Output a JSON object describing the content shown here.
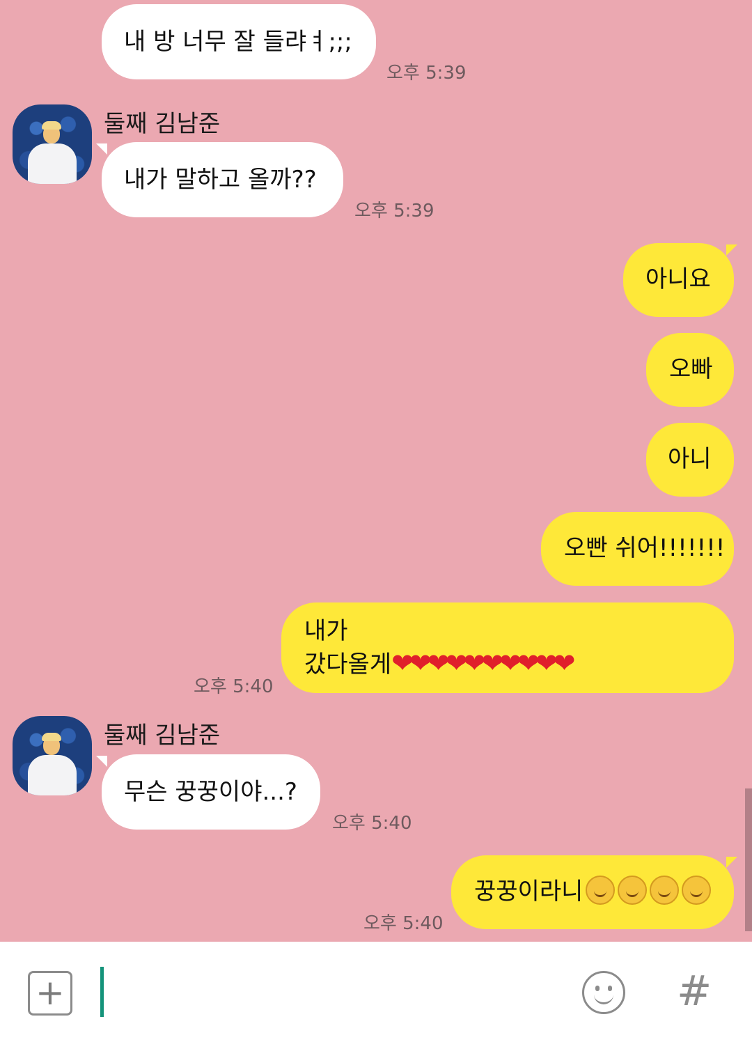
{
  "messages": [
    {
      "text": "내 방 너무 잘 들랴ㅕ;;;",
      "time": "오후 5:39"
    },
    {
      "sender": "둘째 김남준",
      "text": "내가 말하고 올까??",
      "time": "오후 5:39"
    },
    {
      "text": "아니요"
    },
    {
      "text": "오빠"
    },
    {
      "text": "아니"
    },
    {
      "text": "오빤 쉬어!!!!!!!"
    },
    {
      "line1": "내가",
      "line2": "갔다올게",
      "hearts": "❤❤❤❤❤❤❤❤❤❤",
      "time": "오후 5:40"
    },
    {
      "sender": "둘째 김남준",
      "text": "무슨 꿍꿍이야...?",
      "time": "오후 5:40"
    },
    {
      "text": "꿍꿍이라니",
      "time": "오후 5:40"
    }
  ],
  "input": {
    "plus_label": "+",
    "hash_label": "#"
  },
  "icons": {
    "plus": "plus-square-icon",
    "emoji": "smiley-face-icon",
    "hash": "hashtag-icon",
    "heart": "red-heart-emoji",
    "smile": "smiling-face-emoji"
  },
  "colors": {
    "background": "#eba8b1",
    "incoming_bubble": "#ffffff",
    "outgoing_bubble": "#fee839",
    "cursor": "#14937a"
  }
}
